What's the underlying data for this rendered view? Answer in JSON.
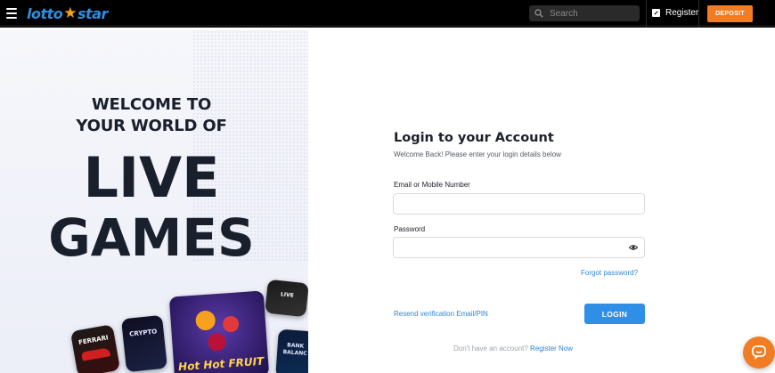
{
  "header": {
    "logo_text_a": "lotto",
    "logo_text_b": "star",
    "search_placeholder": "Search",
    "register_label": "Register",
    "deposit_label": "DEPOSIT",
    "colors": {
      "bar": "#000000",
      "deposit": "#f07d23",
      "logo_blue": "#2f8fe0",
      "logo_star": "#f4a11b"
    }
  },
  "promo": {
    "welcome_line1": "WELCOME TO",
    "welcome_line2": "YOUR WORLD OF",
    "big_line1": "LIVE",
    "big_line2": "GAMES",
    "tiles": [
      {
        "label": "FERRARI",
        "icon": "ferrari-game-tile"
      },
      {
        "label": "CRYPTO",
        "icon": "crypto-game-tile"
      },
      {
        "label": "Hot Hot FRUIT",
        "icon": "hot-hot-fruit-game-tile"
      },
      {
        "label": "LIVE",
        "icon": "live-game-tile"
      },
      {
        "label": "BANK BALANC",
        "icon": "bank-balance-game-tile"
      }
    ]
  },
  "login": {
    "title": "Login to your Account",
    "subtitle": "Welcome Back! Please enter your login details below",
    "email_label": "Email or Mobile Number",
    "email_value": "",
    "password_label": "Password",
    "password_value": "",
    "forgot_label": "Forgot password?",
    "resend_label": "Resend verification Email/PIN",
    "login_button": "LOGIN",
    "no_account_text": "Don't have an account?",
    "register_now": "Register Now",
    "accent": "#2f8fe6"
  }
}
